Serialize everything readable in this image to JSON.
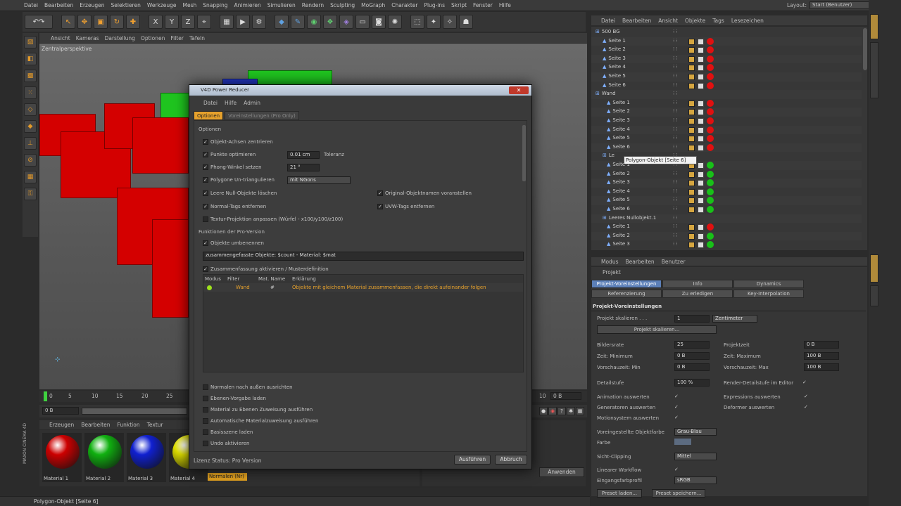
{
  "menubar": {
    "items": [
      "Datei",
      "Bearbeiten",
      "Erzeugen",
      "Selektieren",
      "Werkzeuge",
      "Mesh",
      "Snapping",
      "Animieren",
      "Simulieren",
      "Rendern",
      "Sculpting",
      "MoGraph",
      "Charakter",
      "Plug-ins",
      "Skript",
      "Fenster",
      "Hilfe"
    ],
    "layout_label": "Layout:",
    "layout_value": "Start (Benutzer)"
  },
  "viewport": {
    "menu": [
      "Ansicht",
      "Kameras",
      "Darstellung",
      "Optionen",
      "Filter",
      "Tafeln"
    ],
    "label": "Zentralperspektive"
  },
  "timeline": {
    "ticks": [
      "0",
      "5",
      "10",
      "15",
      "20",
      "25"
    ],
    "end_tick": "10",
    "start_field": "0 B",
    "end_field": "0 B",
    "frame_field": "0 B"
  },
  "materials": {
    "menu": [
      "Erzeugen",
      "Bearbeiten",
      "Funktion",
      "Textur"
    ],
    "items": [
      {
        "label": "Material 1",
        "color": "#cc0000"
      },
      {
        "label": "Material 2",
        "color": "#10b010"
      },
      {
        "label": "Material 3",
        "color": "#1020d0"
      },
      {
        "label": "Material 4",
        "color": "#e0e000"
      }
    ],
    "tag": "Normalen (Nr)"
  },
  "coords": {
    "apply": "Anwenden"
  },
  "status": "Polygon-Objekt [Seite 6]",
  "brand": "MAXON CINEMA 4D",
  "objmgr": {
    "menu": [
      "Datei",
      "Bearbeiten",
      "Ansicht",
      "Objekte",
      "Tags",
      "Lesezeichen"
    ],
    "rows": [
      {
        "name": "500 BG",
        "ind": 6,
        "dot": ""
      },
      {
        "name": "Seite 1",
        "ind": 16,
        "dot": "red"
      },
      {
        "name": "Seite 2",
        "ind": 16,
        "dot": "red"
      },
      {
        "name": "Seite 3",
        "ind": 16,
        "dot": "red"
      },
      {
        "name": "Seite 4",
        "ind": 16,
        "dot": "red"
      },
      {
        "name": "Seite 5",
        "ind": 16,
        "dot": "red"
      },
      {
        "name": "Seite 6",
        "ind": 16,
        "dot": "red"
      },
      {
        "name": "Wand",
        "ind": 6,
        "dot": ""
      },
      {
        "name": "Seite 1",
        "ind": 22,
        "dot": "red"
      },
      {
        "name": "Seite 2",
        "ind": 22,
        "dot": "red"
      },
      {
        "name": "Seite 3",
        "ind": 22,
        "dot": "red"
      },
      {
        "name": "Seite 4",
        "ind": 22,
        "dot": "red"
      },
      {
        "name": "Seite 5",
        "ind": 22,
        "dot": "red"
      },
      {
        "name": "Seite 6",
        "ind": 22,
        "dot": "red"
      },
      {
        "name": "Le",
        "ind": 16,
        "dot": ""
      },
      {
        "name": "Seite 1",
        "ind": 22,
        "dot": "grn"
      },
      {
        "name": "Seite 2",
        "ind": 22,
        "dot": "grn"
      },
      {
        "name": "Seite 3",
        "ind": 22,
        "dot": "grn"
      },
      {
        "name": "Seite 4",
        "ind": 22,
        "dot": "grn"
      },
      {
        "name": "Seite 5",
        "ind": 22,
        "dot": "grn"
      },
      {
        "name": "Seite 6",
        "ind": 22,
        "dot": "grn"
      },
      {
        "name": "Leeres Nullobjekt.1",
        "ind": 16,
        "dot": ""
      },
      {
        "name": "Seite 1",
        "ind": 22,
        "dot": "red"
      },
      {
        "name": "Seite 2",
        "ind": 22,
        "dot": "grn"
      },
      {
        "name": "Seite 3",
        "ind": 22,
        "dot": "grn"
      }
    ],
    "tooltip": "Polygon-Objekt [Seite 6]"
  },
  "attr": {
    "menu": [
      "Modus",
      "Bearbeiten",
      "Benutzer"
    ],
    "header": "Projekt",
    "tabs_row1": [
      "Projekt-Voreinstellungen",
      "Info",
      "Dynamics"
    ],
    "tabs_row2": [
      "Referenzierung",
      "Zu erledigen",
      "Key-Interpolation"
    ],
    "section": "Projekt-Voreinstellungen",
    "scale_label": "Projekt skalieren . . .",
    "scale_value": "1",
    "scale_unit": "Zentimeter",
    "scale_button": "Projekt skalieren...",
    "fps_label": "Bildersrate",
    "fps_value": "25",
    "ptime_label": "Projektzeit",
    "ptime_value": "0 B",
    "tmin_label": "Zeit: Minimum",
    "tmin_value": "0 B",
    "tmax_label": "Zeit: Maximum",
    "tmax_value": "100 B",
    "pmin_label": "Vorschauzeit: Min",
    "pmin_value": "0 B",
    "pmax_label": "Vorschauzeit: Max",
    "pmax_value": "100 B",
    "lod_label": "Detailstufe",
    "lod_value": "100 %",
    "renderlod_label": "Render-Detailstufe im Editor",
    "anim_label": "Animation auswerten",
    "expr_label": "Expressions auswerten",
    "gen_label": "Generatoren auswerten",
    "def_label": "Deformer auswerten",
    "motion_label": "Motionsystem auswerten",
    "color_label": "Voreingestellte Objektfarbe",
    "color_value": "Grau-Blau",
    "farbe_label": "Farbe",
    "clip_label": "Sicht-Clipping",
    "clip_value": "Mittel",
    "linear_label": "Linearer Workflow",
    "profile_label": "Eingangsfarbprofil",
    "profile_value": "sRGB",
    "load_button": "Preset laden...",
    "save_button": "Preset speichern..."
  },
  "dialog": {
    "title": "V4D Power Reducer",
    "menu": [
      "Datei",
      "Hilfe",
      "Admin"
    ],
    "tabs": [
      "Optionen",
      "Voreinstellungen (Pro Only)"
    ],
    "section1": "Optionen",
    "opt1": "Objekt-Achsen zentrieren",
    "opt2": "Punkte optimieren",
    "opt2_value": "0.01 cm",
    "opt2_suffix": "Toleranz",
    "opt3": "Phong-Winkel setzen",
    "opt3_value": "21 °",
    "opt4": "Polygone Un-triangulieren",
    "opt4_value": "mit NGons",
    "opt5": "Leere Null-Objekte löschen",
    "opt5b": "Original-Objektnamen voranstellen",
    "opt6": "Normal-Tags entfernen",
    "opt6b": "UVW-Tags entfernen",
    "opt7": "Textur-Projektion anpassen (Würfel - x100/y100/z100)",
    "section2": "Funktionen der Pro-Version",
    "opt8": "Objekte umbenennen",
    "rename_field": "zusammengefasste Objekte: $count - Material: $mat",
    "opt9": "Zusammenfassung aktivieren / Musterdefinition",
    "table_headers": [
      "Modus",
      "Filter",
      "Mat. Name",
      "Erklärung"
    ],
    "table_row": {
      "filter": "Wand",
      "mat": "#",
      "desc": "Objekte mit gleichem Material zusammenfassen, die direkt aufeinander folgen"
    },
    "opt10": "Normalen nach außen ausrichten",
    "opt11": "Ebenen-Vorgabe laden",
    "opt12": "Material zu Ebenen Zuweisung ausführen",
    "opt13": "Automatische Materialzuweisung ausführen",
    "opt14": "Basisszene laden",
    "opt15": "Undo aktivieren",
    "status": "Lizenz Status: Pro Version",
    "run": "Ausführen",
    "cancel": "Abbruch"
  }
}
